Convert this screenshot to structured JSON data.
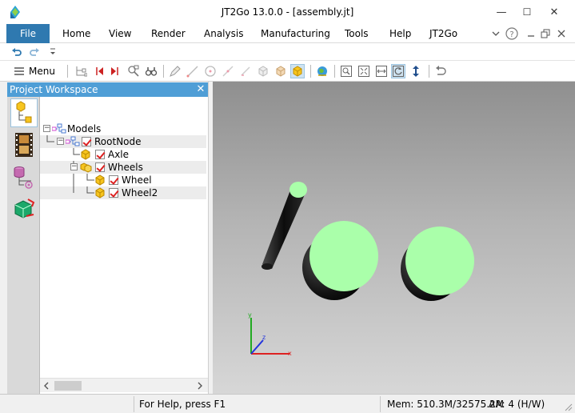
{
  "window": {
    "title": "JT2Go 13.0.0 - [assembly.jt]",
    "minimize": "—",
    "maximize": "☐",
    "close": "✕"
  },
  "menubar": {
    "file": "File",
    "tabs": [
      "Home",
      "View",
      "Render",
      "Analysis",
      "Manufacturing",
      "Tools",
      "Help",
      "JT2Go"
    ]
  },
  "toolbar": {
    "menu_label": "Menu"
  },
  "workspace": {
    "title": "Project Workspace",
    "close": "✕",
    "tree": [
      {
        "label": "Models"
      },
      {
        "label": "RootNode"
      },
      {
        "label": "Axle"
      },
      {
        "label": "Wheels"
      },
      {
        "label": "Wheel"
      },
      {
        "label": "Wheel2"
      }
    ]
  },
  "triad": {
    "y": "y",
    "z": "z",
    "x": "x"
  },
  "status": {
    "help": "For Help, press F1",
    "memory": "Mem: 510.3M/32575.2M",
    "aa": "AA: 4 (H/W)"
  },
  "colors": {
    "accent": "#2f79b0",
    "panel_header": "#4f9ed6",
    "part_face": "#aaffaa"
  }
}
